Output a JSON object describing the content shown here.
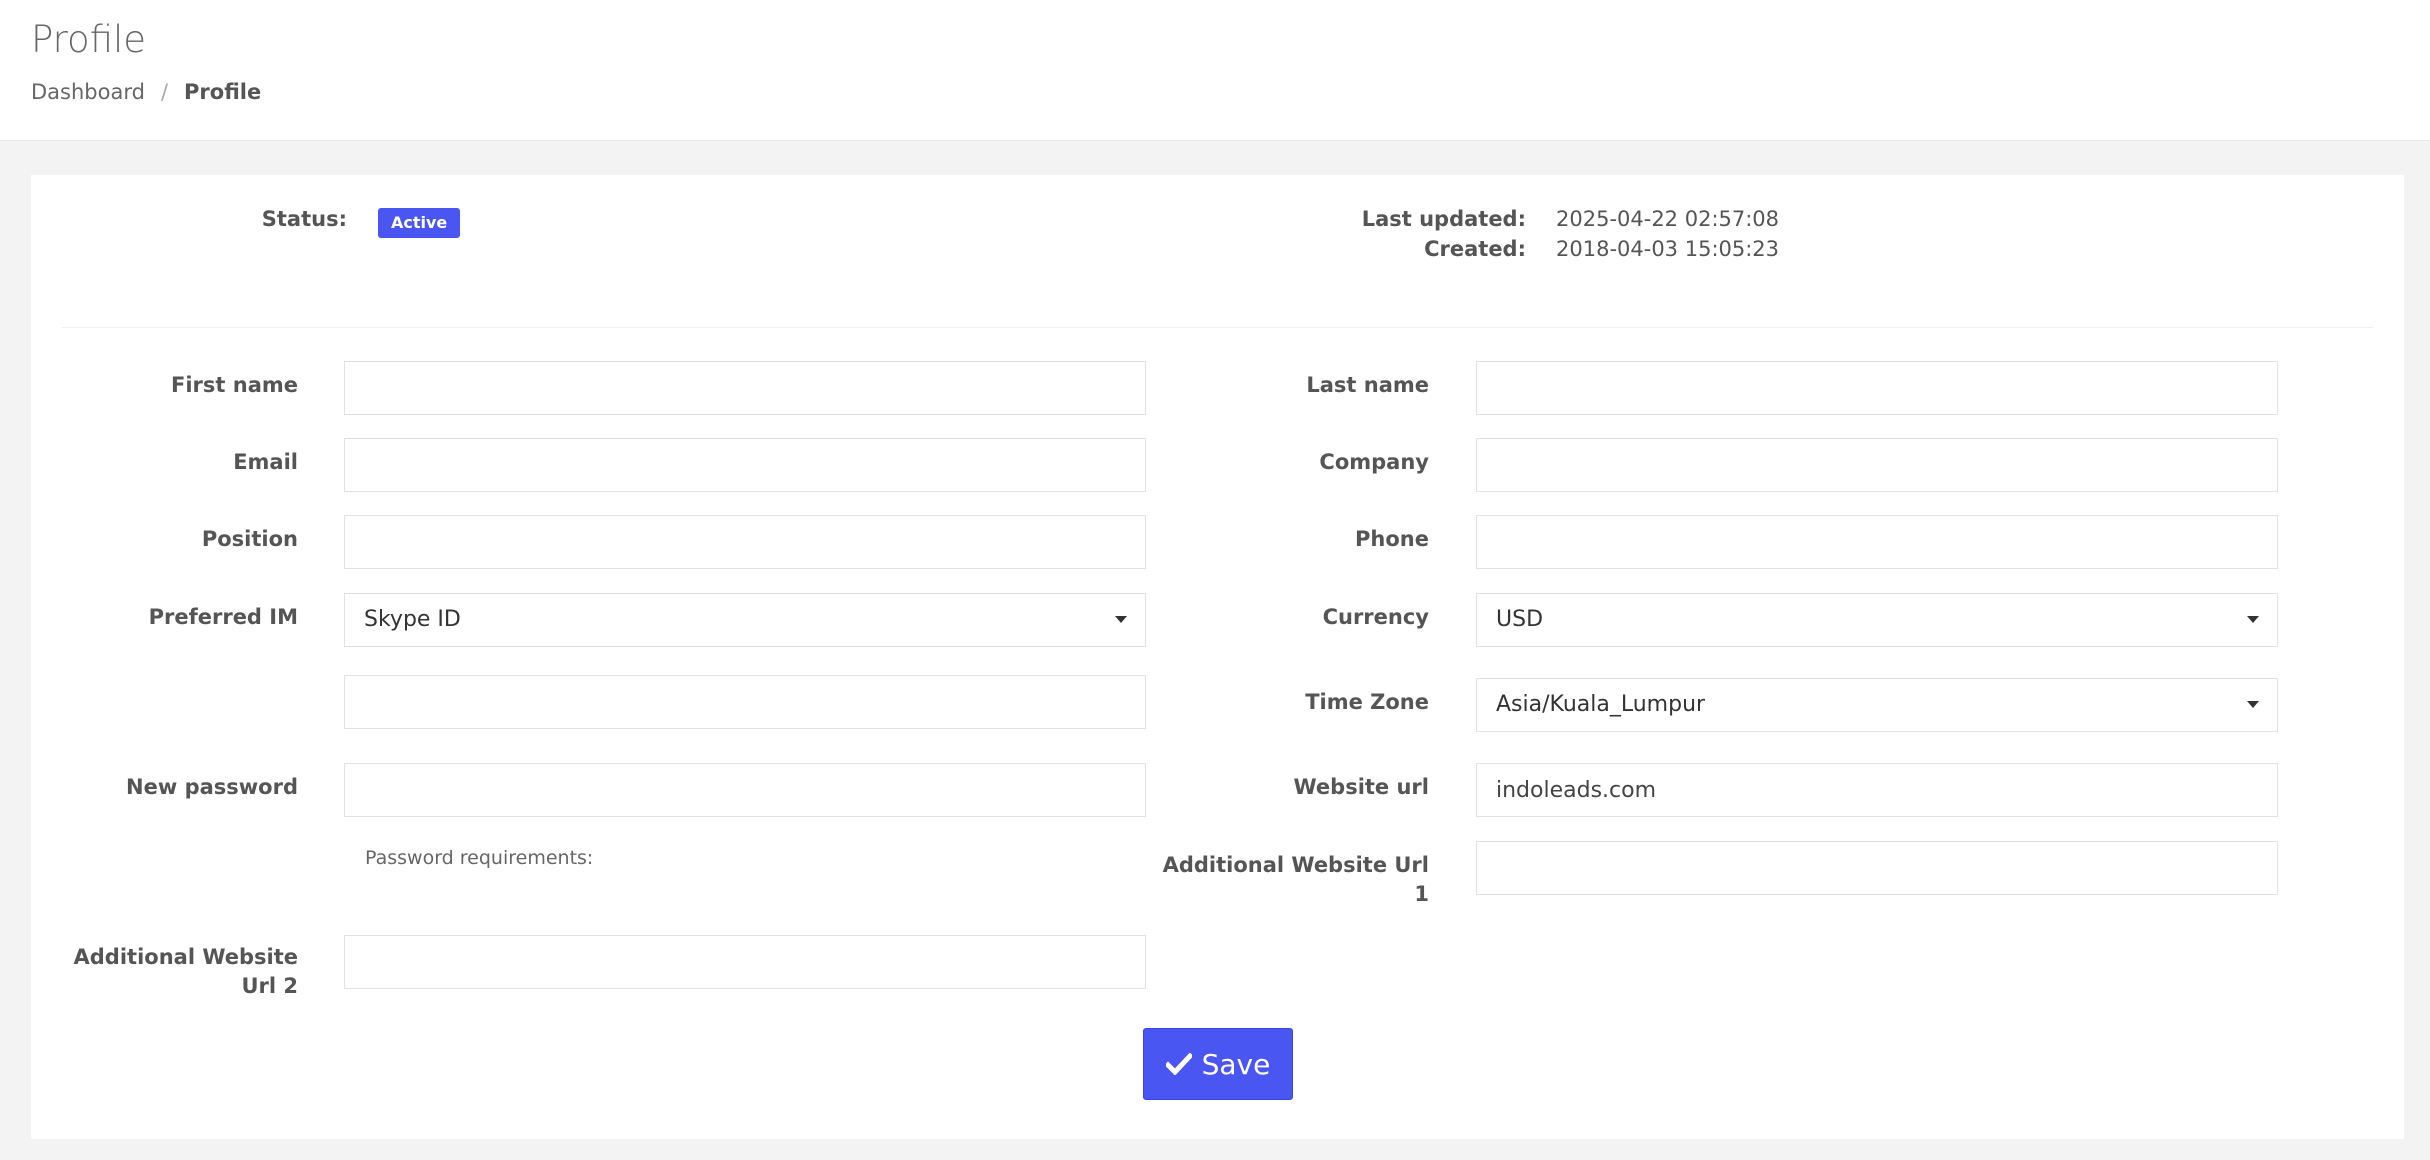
{
  "header": {
    "title": "Profile",
    "breadcrumb": [
      "Dashboard",
      "Profile"
    ],
    "separator": "/"
  },
  "meta": {
    "status_label": "Status:",
    "status_value": "Active",
    "last_updated_label": "Last updated:",
    "last_updated_value": "2025-04-22 02:57:08",
    "created_label": "Created:",
    "created_value": "2018-04-03 15:05:23"
  },
  "form": {
    "first_name": {
      "label": "First name",
      "value": ""
    },
    "last_name": {
      "label": "Last name",
      "value": ""
    },
    "email": {
      "label": "Email",
      "value": ""
    },
    "company": {
      "label": "Company",
      "value": ""
    },
    "position": {
      "label": "Position",
      "value": ""
    },
    "phone": {
      "label": "Phone",
      "value": ""
    },
    "preferred_im": {
      "label": "Preferred IM",
      "value": "Skype ID"
    },
    "im_account": {
      "value": ""
    },
    "currency": {
      "label": "Currency",
      "value": "USD"
    },
    "time_zone": {
      "label": "Time Zone",
      "value": "Asia/Kuala_Lumpur"
    },
    "new_password": {
      "label": "New password",
      "value": ""
    },
    "password_hint": "Password requirements:",
    "website_url": {
      "label": "Website url",
      "value": "indoleads.com"
    },
    "additional_url_1": {
      "label": "Additional Website Url 1",
      "value": ""
    },
    "additional_url_2": {
      "label": "Additional Website Url 2",
      "value": ""
    }
  },
  "actions": {
    "save_label": "Save"
  },
  "colors": {
    "accent": "#4a56f1"
  }
}
